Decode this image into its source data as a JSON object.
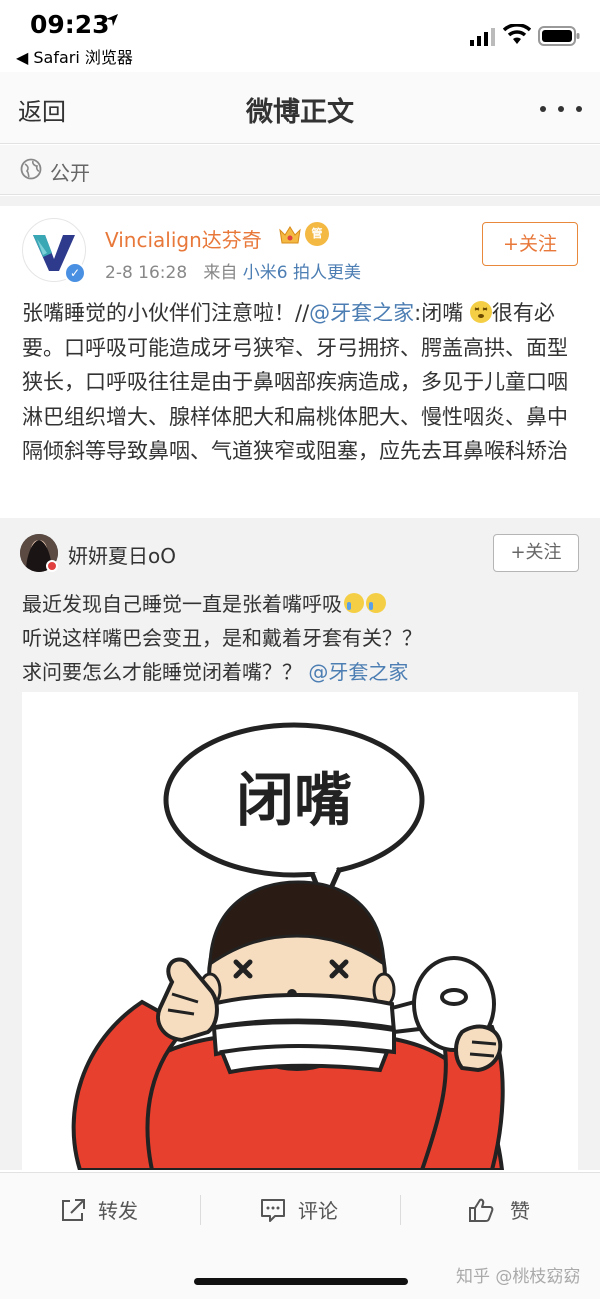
{
  "status_bar": {
    "time": "09:23",
    "back_app": "◀ Safari 浏览器"
  },
  "nav": {
    "back_label": "返回",
    "title": "微博正文"
  },
  "visibility": {
    "label": "公开",
    "icon": "globe-icon"
  },
  "post": {
    "author": "Vincialign达芬奇",
    "date": "2-8 16:28",
    "from_label": "来自",
    "device": "小米6 拍人更美",
    "follow_label": "+关注",
    "text_before_mention": "张嘴睡觉的小伙伴们注意啦！//",
    "mention": "@牙套之家",
    "text_after_mention": ":闭嘴",
    "text_rest": "很有必要。口呼吸可能造成牙弓狭窄、牙弓拥挤、腭盖高拱、面型狭长，口呼吸往往是由于鼻咽部疾病造成，多见于儿童口咽淋巴组织增大、腺样体肥大和扁桃体肥大、慢性咽炎、鼻中隔倾斜等导致鼻咽、气道狭窄或阻塞，应先去耳鼻喉科矫治",
    "badges": [
      "crown-icon",
      "vip-icon"
    ],
    "vip_badge_text": "管"
  },
  "repost": {
    "author": "妍妍夏日oO",
    "follow_label": "+关注",
    "line1": "最近发现自己睡觉一直是张着嘴呼吸",
    "line2": "听说这样嘴巴会变丑，是和戴着牙套有关？？",
    "line3": "求问要怎么才能睡觉闭着嘴？？",
    "mention": "@牙套之家",
    "image_text": "闭嘴"
  },
  "actions": {
    "repost_label": "转发",
    "comment_label": "评论",
    "like_label": "赞"
  },
  "watermark": "知乎 @桃枝窈窈",
  "colors": {
    "accent_orange": "#e8783a",
    "link_blue": "#4c7eb3",
    "comic_red": "#e8402e"
  }
}
